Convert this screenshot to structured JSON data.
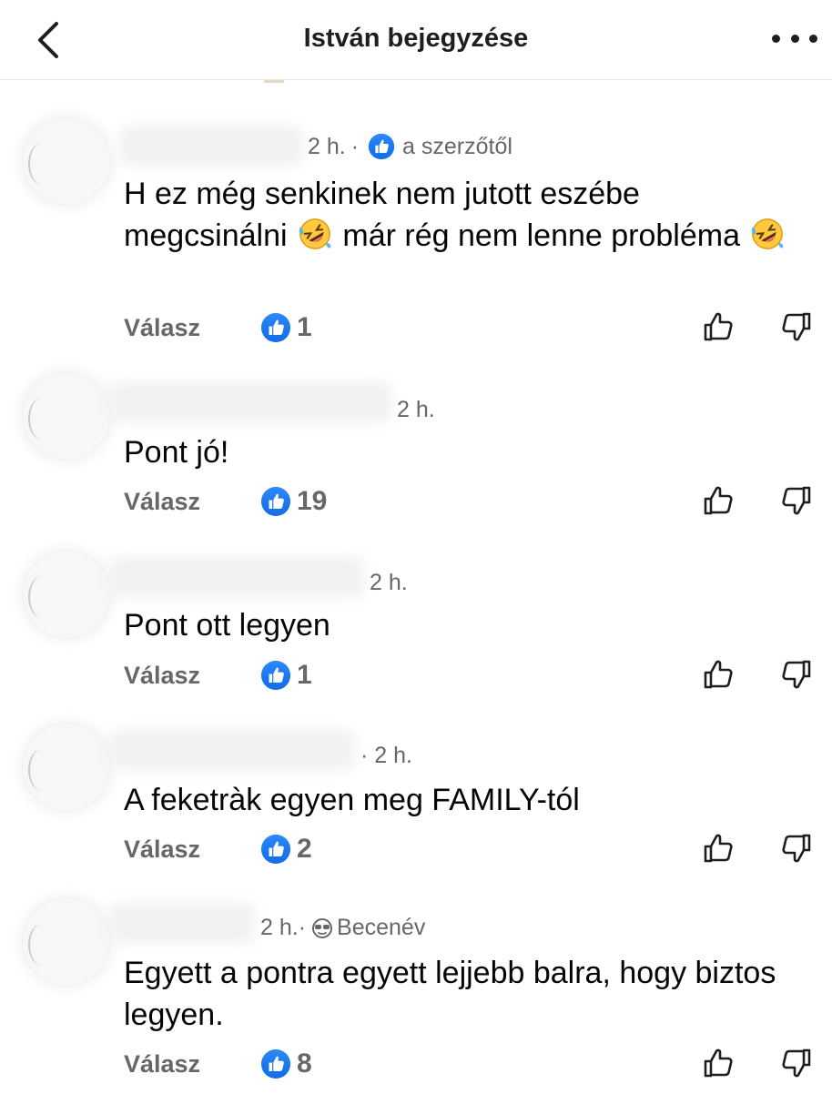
{
  "header": {
    "title": "István bejegyzése"
  },
  "comments": [
    {
      "time": "2 h.",
      "author_badge": "a szerzőtől",
      "text_parts": [
        "H ez még senkinek nem jutott eszébe megcsinálni ",
        " már rég nem lenne probléma "
      ],
      "reply_label": "Válasz",
      "likes": "1"
    },
    {
      "time": "2 h.",
      "text": "Pont jó!",
      "reply_label": "Válasz",
      "likes": "19"
    },
    {
      "time": "2 h.",
      "text": "Pont ott legyen",
      "reply_label": "Válasz",
      "likes": "1"
    },
    {
      "time": "· 2 h.",
      "text": "A feketràk egyen meg FAMILY-tól",
      "reply_label": "Válasz",
      "likes": "2"
    },
    {
      "time": "2 h.·",
      "nickname_label": "Becenév",
      "text": "Egyett a pontra egyett lejjebb balra, hogy biztos legyen.",
      "reply_label": "Válasz",
      "likes": "8"
    }
  ],
  "icons": {
    "back": "chevron-left-icon",
    "more": "more-dots-icon",
    "like": "thumbs-up-bubble-icon",
    "upvote": "thumbs-up-outline-icon",
    "downvote": "thumbs-down-outline-icon",
    "emoji": "rolling-on-floor-laughing-emoji",
    "nickname": "sunglasses-icon"
  },
  "colors": {
    "like_blue": "#1877f2",
    "meta_gray": "#65676b",
    "text": "#050505"
  }
}
